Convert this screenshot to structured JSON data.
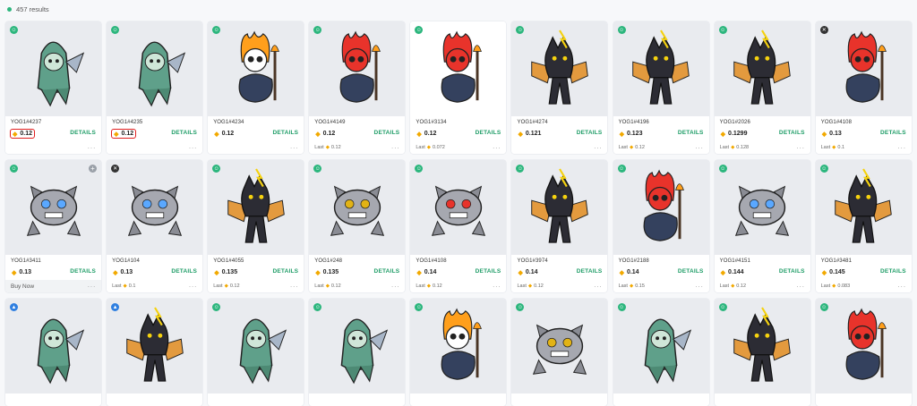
{
  "results_text": "457 results",
  "details_label": "DETAILS",
  "buy_now_label": "Buy Now",
  "more_label": "···",
  "last_label": "Last",
  "rows": [
    [
      {
        "name": "YOG1#4237",
        "price": "0.12",
        "last": null,
        "badge": "green",
        "type": "hood",
        "highlight": true
      },
      {
        "name": "YOG1#4235",
        "price": "0.12",
        "last": null,
        "badge": "green",
        "type": "hood",
        "highlight": true
      },
      {
        "name": "YOG1#4234",
        "price": "0.12",
        "last": null,
        "badge": "green",
        "type": "skull-fire-orange"
      },
      {
        "name": "YOG1#4149",
        "price": "0.12",
        "last": "0.12",
        "badge": "green",
        "type": "skull-fire-red"
      },
      {
        "name": "YOG1#3134",
        "price": "0.12",
        "last": "0.072",
        "badge": "green",
        "type": "skull-fire-red",
        "white": true
      },
      {
        "name": "YOG1#4274",
        "price": "0.121",
        "last": null,
        "badge": "green",
        "type": "bat-black"
      },
      {
        "name": "YOG1#4196",
        "price": "0.123",
        "last": "0.12",
        "badge": "green",
        "type": "bat-black"
      },
      {
        "name": "YOG1#2026",
        "price": "0.1299",
        "last": "0.128",
        "badge": "green",
        "type": "bat-black"
      },
      {
        "name": "YOG1#4108",
        "price": "0.13",
        "last": "0.1",
        "badge": "dark",
        "type": "skull-fire-red"
      }
    ],
    [
      {
        "name": "YOG1#3411",
        "price": "0.13",
        "last": null,
        "badge": "green",
        "type": "golem-blue",
        "plus": true,
        "buy": true
      },
      {
        "name": "YOG1#104",
        "price": "0.13",
        "last": "0.1",
        "badge": "dark",
        "type": "golem-blue"
      },
      {
        "name": "YOG1#4055",
        "price": "0.135",
        "last": "0.12",
        "badge": "green",
        "type": "bat-black"
      },
      {
        "name": "YOG1#248",
        "price": "0.135",
        "last": "0.12",
        "badge": "green",
        "type": "golem-yellow"
      },
      {
        "name": "YOG1#4108",
        "price": "0.14",
        "last": "0.12",
        "badge": "green",
        "type": "golem-red"
      },
      {
        "name": "YOG1#3974",
        "price": "0.14",
        "last": "0.12",
        "badge": "green",
        "type": "bat-black"
      },
      {
        "name": "YOG1#2188",
        "price": "0.14",
        "last": "0.15",
        "badge": "green",
        "type": "skull-fire-red"
      },
      {
        "name": "YOG1#4151",
        "price": "0.144",
        "last": "0.12",
        "badge": "green",
        "type": "golem-blue"
      },
      {
        "name": "YOG1#3481",
        "price": "0.145",
        "last": "0.083",
        "badge": "green",
        "type": "bat-black"
      }
    ],
    [
      {
        "badge": "blue",
        "type": "hood"
      },
      {
        "badge": "blue",
        "type": "bat-black"
      },
      {
        "badge": "green",
        "type": "hood"
      },
      {
        "badge": "green",
        "type": "hood"
      },
      {
        "badge": "green",
        "type": "skull-fire-orange"
      },
      {
        "badge": "green",
        "type": "golem-yellow"
      },
      {
        "badge": "green",
        "type": "hood"
      },
      {
        "badge": "green",
        "type": "bat-black"
      },
      {
        "badge": "green",
        "type": "skull-fire-red"
      }
    ]
  ]
}
